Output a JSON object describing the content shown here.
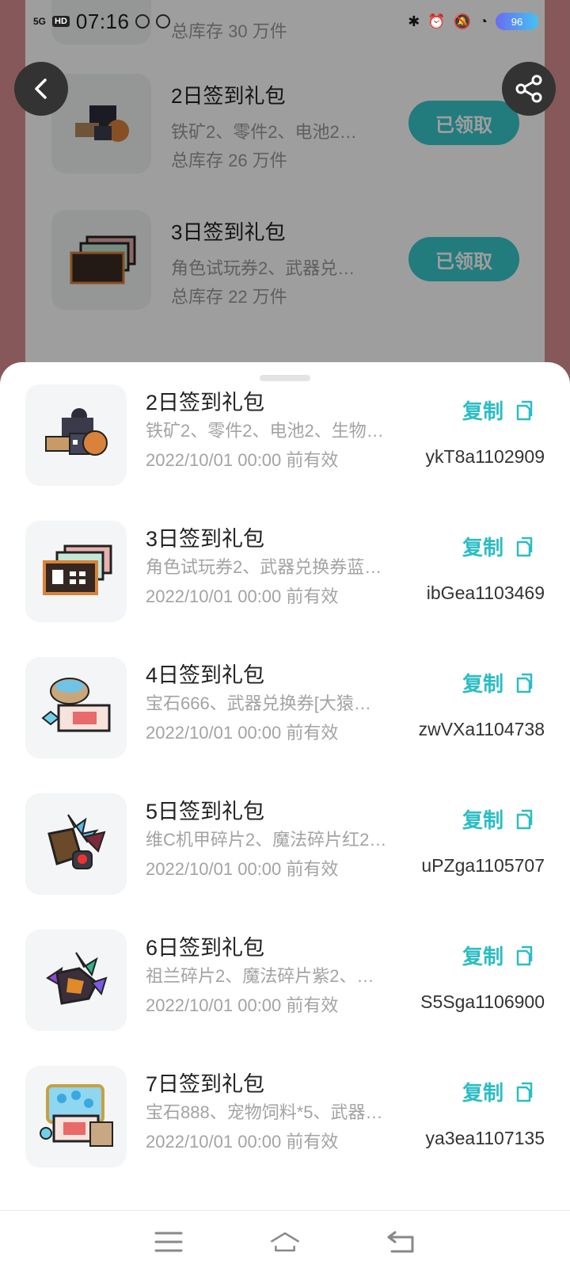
{
  "status_bar": {
    "signal": "5G",
    "hd": "HD",
    "time": "07:16",
    "battery": "96"
  },
  "background": {
    "rows": [
      {
        "title": "",
        "desc": "",
        "stock": "总库存 30 万件",
        "button": ""
      },
      {
        "title": "2日签到礼包",
        "desc": "铁矿2、零件2、电池2…",
        "stock": "总库存 26 万件",
        "button": "已领取"
      },
      {
        "title": "3日签到礼包",
        "desc": "角色试玩券2、武器兑…",
        "stock": "总库存 22 万件",
        "button": "已领取"
      }
    ]
  },
  "sheet": {
    "copy_label": "复制",
    "items": [
      {
        "title": "2日签到礼包",
        "desc": "铁矿2、零件2、电池2、生物…",
        "valid": "2022/10/01 00:00 前有效",
        "code": "ykT8a1102909",
        "icon": "mining-gear-icon"
      },
      {
        "title": "3日签到礼包",
        "desc": "角色试玩券2、武器兑换券蓝…",
        "valid": "2022/10/01 00:00 前有效",
        "code": "ibGea1103469",
        "icon": "ticket-stack-icon"
      },
      {
        "title": "4日签到礼包",
        "desc": "宝石666、武器兑换券[大猿…",
        "valid": "2022/10/01 00:00 前有效",
        "code": "zwVXa1104738",
        "icon": "gem-bag-ticket-icon"
      },
      {
        "title": "5日签到礼包",
        "desc": "维C机甲碎片2、魔法碎片红2…",
        "valid": "2022/10/01 00:00 前有效",
        "code": "uPZga1105707",
        "icon": "mech-fragment-icon"
      },
      {
        "title": "6日签到礼包",
        "desc": "祖兰碎片2、魔法碎片紫2、…",
        "valid": "2022/10/01 00:00 前有效",
        "code": "S5Sga1106900",
        "icon": "crystal-fragment-icon"
      },
      {
        "title": "7日签到礼包",
        "desc": "宝石888、宠物饲料*5、武器…",
        "valid": "2022/10/01 00:00 前有效",
        "code": "ya3ea1107135",
        "icon": "gem-chest-ticket-icon"
      }
    ]
  },
  "colors": {
    "accent": "#2bbdc4",
    "claimed_button": "#38c7c9"
  }
}
